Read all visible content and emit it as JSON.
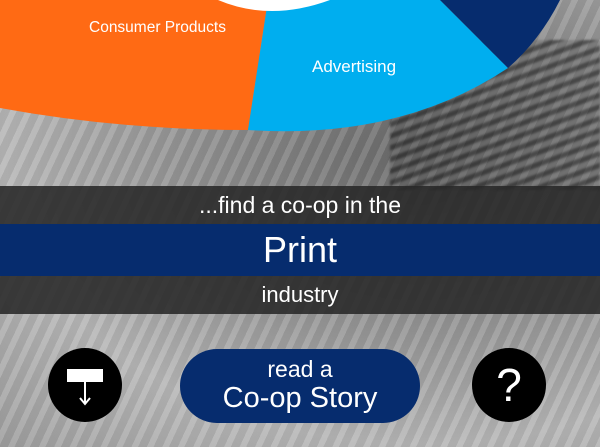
{
  "wheel": {
    "segments": [
      {
        "label": "Consumer Products",
        "color": "#ff6a14"
      },
      {
        "label": "Advertising",
        "color": "#00aeef"
      },
      {
        "label": "",
        "color": "#062c6e"
      }
    ],
    "hub_color": "#ffffff"
  },
  "headline": {
    "prefix": "...find a co-op in the",
    "industry": "Print",
    "suffix": "industry"
  },
  "actions": {
    "story_line1": "read a",
    "story_line2": "Co-op Story",
    "help_symbol": "?"
  },
  "colors": {
    "brand_navy": "#062c6e",
    "band_dark": "#282828",
    "button_black": "#000000"
  }
}
